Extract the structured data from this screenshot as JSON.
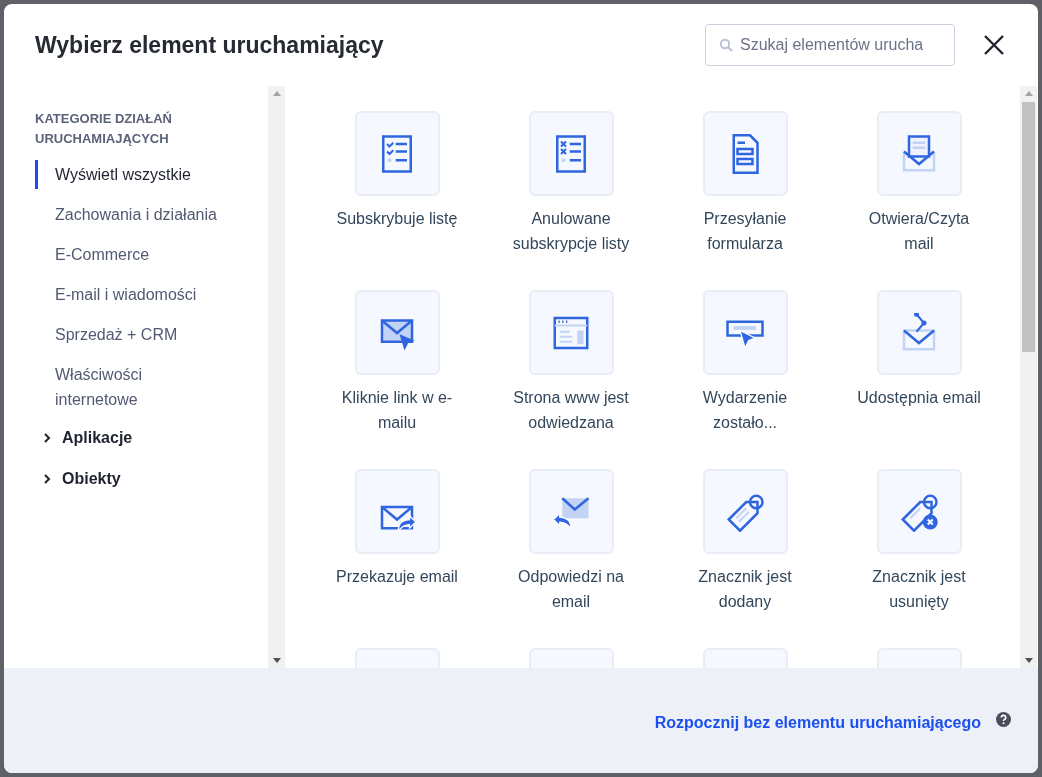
{
  "dialog": {
    "title": "Wybierz element uruchamiający",
    "search": {
      "placeholder": "Szukaj elementów urucha"
    }
  },
  "sidebar": {
    "heading": "KATEGORIE DZIAŁAŃ URUCHAMIAJĄCYCH",
    "items": [
      {
        "label": "Wyświetl wszystkie",
        "selected": true
      },
      {
        "label": "Zachowania i działania",
        "selected": false
      },
      {
        "label": "E-Commerce",
        "selected": false
      },
      {
        "label": "E-mail i wiadomości",
        "selected": false
      },
      {
        "label": "Sprzedaż + CRM",
        "selected": false
      },
      {
        "label": "Właściwości internetowe",
        "selected": false
      }
    ],
    "groups": [
      {
        "label": "Aplikacje",
        "expanded": false
      },
      {
        "label": "Obiekty",
        "expanded": false
      }
    ]
  },
  "triggers": [
    {
      "kind": "tile",
      "label": "Subskrybuje listę"
    },
    {
      "kind": "tile",
      "label": "Anulowane subskrypcje listy"
    },
    {
      "kind": "tile",
      "label": "Przesyłanie formularza"
    },
    {
      "kind": "tile",
      "label": "Otwiera/Czyta mail"
    },
    {
      "kind": "tile",
      "label": "Kliknie link w e-mailu"
    },
    {
      "kind": "tile",
      "label": "Strona www jest odwiedzana"
    },
    {
      "kind": "tile",
      "label": "Wydarzenie zostało..."
    },
    {
      "kind": "tile",
      "label": "Udostępnia email"
    },
    {
      "kind": "tile",
      "label": "Przekazuje email"
    },
    {
      "kind": "tile",
      "label": "Odpowiedzi na email"
    },
    {
      "kind": "tile",
      "label": "Znacznik jest dodany"
    },
    {
      "kind": "tile",
      "label": "Znacznik jest usunięty"
    },
    {
      "kind": "cut"
    },
    {
      "kind": "cut"
    },
    {
      "kind": "cut"
    },
    {
      "kind": "cut"
    }
  ],
  "footer": {
    "link": "Rozpocznij bez elementu uruchamiającego"
  }
}
